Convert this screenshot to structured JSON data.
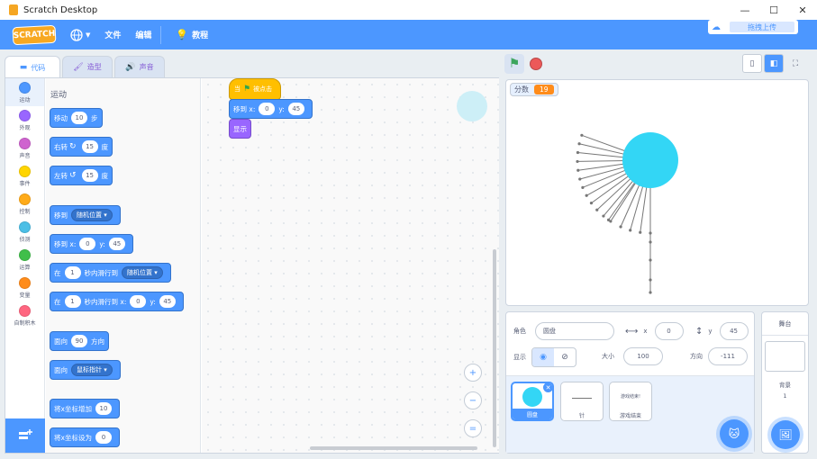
{
  "window": {
    "title": "Scratch Desktop",
    "minimize": "—",
    "maximize": "☐",
    "close": "✕"
  },
  "menubar": {
    "logo": "SCRATCH",
    "language_icon": "globe-icon",
    "file": "文件",
    "edit": "编辑",
    "tutorials": "教程",
    "upload": "拖拽上传"
  },
  "tabs": {
    "code": "代码",
    "costumes": "造型",
    "sounds": "声音"
  },
  "categories": [
    {
      "label": "运动",
      "color": "#4c97ff"
    },
    {
      "label": "外观",
      "color": "#9966ff"
    },
    {
      "label": "声音",
      "color": "#cf63cf"
    },
    {
      "label": "事件",
      "color": "#ffd500"
    },
    {
      "label": "控制",
      "color": "#ffab19"
    },
    {
      "label": "侦测",
      "color": "#4cbfe6"
    },
    {
      "label": "运算",
      "color": "#40bf4a"
    },
    {
      "label": "变量",
      "color": "#ff8c1a"
    },
    {
      "label": "自制积木",
      "color": "#ff6680"
    }
  ],
  "palette": {
    "title": "运动",
    "move": {
      "a": "移动",
      "v": "10",
      "b": "步"
    },
    "turn_right": {
      "a": "右转",
      "v": "15",
      "b": "度"
    },
    "turn_left": {
      "a": "左转",
      "v": "15",
      "b": "度"
    },
    "goto": {
      "a": "移到",
      "dd": "随机位置"
    },
    "goto_xy": {
      "a": "移到 x:",
      "x": "0",
      "yl": "y:",
      "y": "45"
    },
    "glide": {
      "a": "在",
      "v": "1",
      "b": "秒内滑行到",
      "dd": "随机位置"
    },
    "glide_xy": {
      "a": "在",
      "v": "1",
      "b": "秒内滑行到 x:",
      "x": "0",
      "yl": "y:",
      "y": "45"
    },
    "point_dir": {
      "a": "面向",
      "v": "90",
      "b": "方向"
    },
    "point_towards": {
      "a": "面向",
      "dd": "鼠标指针"
    },
    "change_x": {
      "a": "将x坐标增加",
      "v": "10"
    },
    "set_x": {
      "a": "将x坐标设为",
      "v": "0"
    }
  },
  "script": {
    "hat": {
      "a": "当",
      "b": "被点击"
    },
    "goto_xy": {
      "a": "移到 x:",
      "x": "0",
      "yl": "y:",
      "y": "45"
    },
    "show": "显示"
  },
  "zoom": {
    "in": "+",
    "out": "−",
    "reset": "="
  },
  "stage": {
    "monitor_label": "分数",
    "monitor_value": "19"
  },
  "sprite_info": {
    "sprite_label": "角色",
    "sprite_name": "圆盘",
    "x_label": "x",
    "x": "0",
    "y_label": "y",
    "y": "45",
    "show_label": "显示",
    "size_label": "大小",
    "size": "100",
    "direction_label": "方向",
    "direction": "-111"
  },
  "sprites": [
    {
      "name": "圆盘"
    },
    {
      "name": "针"
    },
    {
      "name": "游戏结束",
      "thumb_text": "游戏结束!"
    }
  ],
  "stage_panel": {
    "title": "舞台",
    "backdrop_label": "背景",
    "backdrop_count": "1"
  },
  "colors": {
    "accent": "#4c97ff",
    "disc": "#33d6f5",
    "needle": "#777777"
  }
}
